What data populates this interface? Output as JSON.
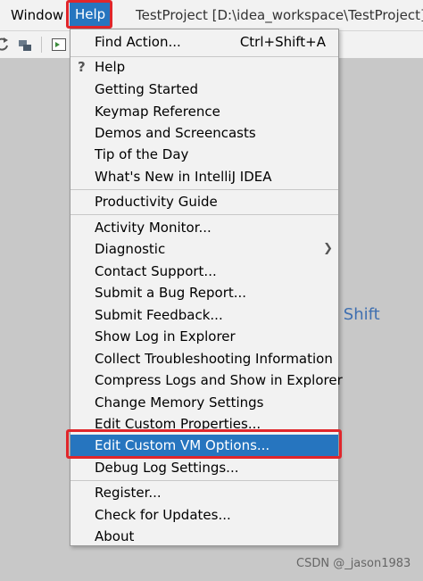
{
  "menubar": {
    "window_label": "Window",
    "help_label": "Help",
    "title": "TestProject [D:\\idea_workspace\\TestProject]"
  },
  "background_hint": "e Shift",
  "help_menu": {
    "items": [
      {
        "label": "Find Action...",
        "shortcut": "Ctrl+Shift+A"
      },
      {
        "label": "Help"
      },
      {
        "label": "Getting Started"
      },
      {
        "label": "Keymap Reference"
      },
      {
        "label": "Demos and Screencasts"
      },
      {
        "label": "Tip of the Day"
      },
      {
        "label": "What's New in IntelliJ IDEA"
      },
      {
        "label": "Productivity Guide"
      },
      {
        "label": "Activity Monitor..."
      },
      {
        "label": "Diagnostic"
      },
      {
        "label": "Contact Support..."
      },
      {
        "label": "Submit a Bug Report..."
      },
      {
        "label": "Submit Feedback..."
      },
      {
        "label": "Show Log in Explorer"
      },
      {
        "label": "Collect Troubleshooting Information"
      },
      {
        "label": "Compress Logs and Show in Explorer"
      },
      {
        "label": "Change Memory Settings"
      },
      {
        "label": "Edit Custom Properties..."
      },
      {
        "label": "Edit Custom VM Options..."
      },
      {
        "label": "Debug Log Settings..."
      },
      {
        "label": "Register..."
      },
      {
        "label": "Check for Updates..."
      },
      {
        "label": "About"
      }
    ]
  },
  "watermark": "CSDN @_jason1983",
  "colors": {
    "accent": "#2675bf",
    "highlight_outline": "#e0262b",
    "menu_bg": "#f2f2f2",
    "workspace_bg": "#c8c8c8"
  },
  "icons": {
    "help_item": "question-mark-icon",
    "diagnostic_submenu": "chevron-right-icon"
  }
}
